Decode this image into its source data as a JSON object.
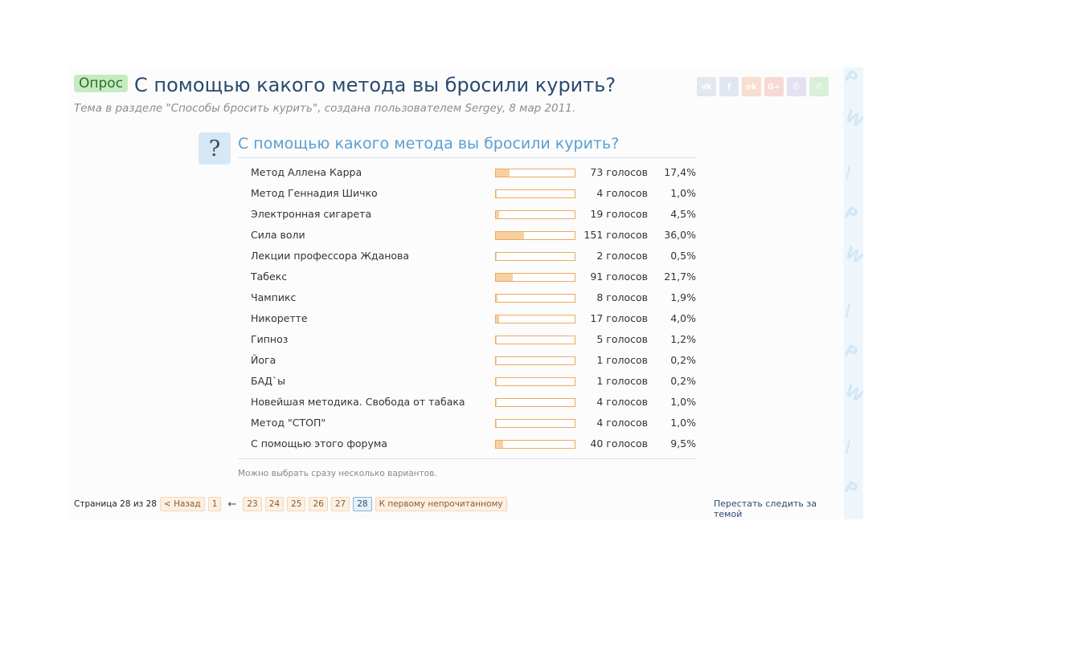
{
  "thread": {
    "prefix": "Опрос",
    "title": "С помощью какого метода вы бросили курить?",
    "description": "Тема в разделе \"Способы бросить курить\", создана пользователем Sergey, 8 мар 2011."
  },
  "share": [
    {
      "icon": "vk-icon",
      "glyph": "vk"
    },
    {
      "icon": "facebook-icon",
      "glyph": "f"
    },
    {
      "icon": "odnoklassniki-icon",
      "glyph": "ok"
    },
    {
      "icon": "google-plus-icon",
      "glyph": "G+"
    },
    {
      "icon": "viber-icon",
      "glyph": "✆"
    },
    {
      "icon": "whatsapp-icon",
      "glyph": "✆"
    }
  ],
  "poll": {
    "icon_glyph": "?",
    "question": "С помощью какого метода вы бросили курить?",
    "options": [
      {
        "label": "Метод Аллена Карра",
        "votes": "73 голосов",
        "percent": "17,4%",
        "share": 17.4
      },
      {
        "label": "Метод Геннадия Шичко",
        "votes": "4 голосов",
        "percent": "1,0%",
        "share": 1.0
      },
      {
        "label": "Электронная сигарета",
        "votes": "19 голосов",
        "percent": "4,5%",
        "share": 4.5
      },
      {
        "label": "Сила воли",
        "votes": "151 голосов",
        "percent": "36,0%",
        "share": 36.0
      },
      {
        "label": "Лекции профессора Жданова",
        "votes": "2 голосов",
        "percent": "0,5%",
        "share": 0.5
      },
      {
        "label": "Табекс",
        "votes": "91 голосов",
        "percent": "21,7%",
        "share": 21.7
      },
      {
        "label": "Чампикс",
        "votes": "8 голосов",
        "percent": "1,9%",
        "share": 1.9
      },
      {
        "label": "Никоретте",
        "votes": "17 голосов",
        "percent": "4,0%",
        "share": 4.0
      },
      {
        "label": "Гипноз",
        "votes": "5 голосов",
        "percent": "1,2%",
        "share": 1.2
      },
      {
        "label": "Йога",
        "votes": "1 голосов",
        "percent": "0,2%",
        "share": 0.2
      },
      {
        "label": "БАД`ы",
        "votes": "1 голосов",
        "percent": "0,2%",
        "share": 0.2
      },
      {
        "label": "Новейшая методика. Свобода от табака",
        "votes": "4 голосов",
        "percent": "1,0%",
        "share": 1.0
      },
      {
        "label": "Метод \"СТОП\"",
        "votes": "4 голосов",
        "percent": "1,0%",
        "share": 1.0
      },
      {
        "label": "С помощью этого форума",
        "votes": "40 голосов",
        "percent": "9,5%",
        "share": 9.5
      }
    ],
    "note": "Можно выбрать сразу несколько вариантов."
  },
  "pagination": {
    "label": "Страница 28 из 28",
    "prev": "< Назад",
    "first": "1",
    "ellipsis_arrow": "←",
    "pages": [
      "23",
      "24",
      "25",
      "26",
      "27",
      "28"
    ],
    "current": "28",
    "first_unread": "К первому непрочитанному"
  },
  "unwatch": "Перестать следить за темой",
  "colors": {
    "prefix_bg": "#c5ecc0",
    "title": "#2a4b6d",
    "question": "#5a9fd0",
    "bar_border": "#eda95e",
    "bar_fill": "#f7d0a2"
  }
}
